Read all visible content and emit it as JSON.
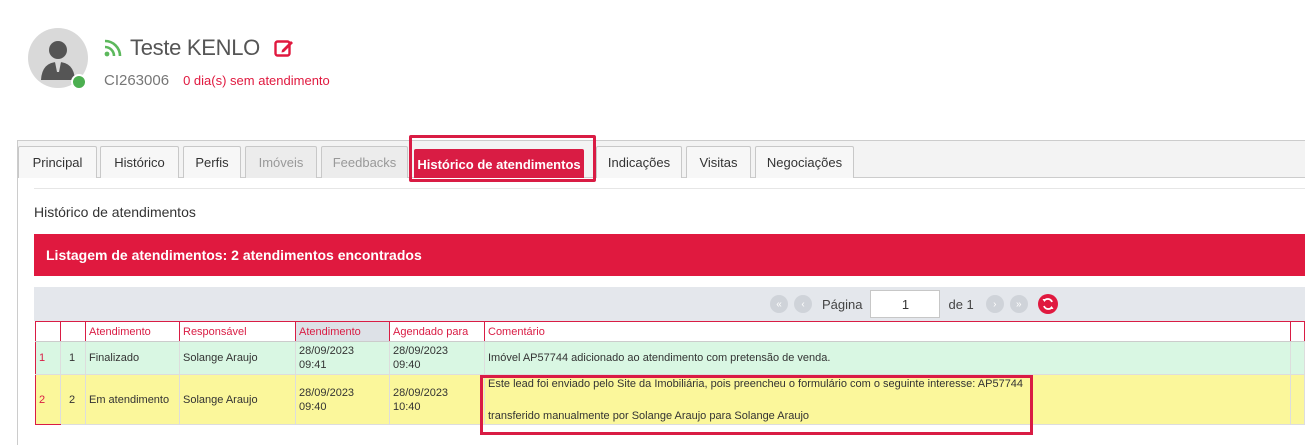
{
  "header": {
    "name": "Teste KENLO",
    "code": "CI263006",
    "days_count": "0 dia(s)",
    "days_suffix": "sem atendimento"
  },
  "tabs": [
    {
      "label": "Principal",
      "state": "normal"
    },
    {
      "label": "Histórico",
      "state": "normal"
    },
    {
      "label": "Perfis",
      "state": "normal"
    },
    {
      "label": "Imóveis",
      "state": "disabled"
    },
    {
      "label": "Feedbacks",
      "state": "disabled"
    },
    {
      "label": "Histórico de atendimentos",
      "state": "active"
    },
    {
      "label": "Indicações",
      "state": "normal"
    },
    {
      "label": "Visitas",
      "state": "normal"
    },
    {
      "label": "Negociações",
      "state": "normal"
    }
  ],
  "section_title": "Histórico de atendimentos",
  "listing_title": "Listagem de atendimentos: 2 atendimentos encontrados",
  "pager": {
    "page_label": "Página",
    "page_value": "1",
    "of_label": "de 1"
  },
  "table": {
    "columns": [
      "Atendimento",
      "Responsável",
      "Atendimento",
      "Agendado para",
      "Comentário"
    ],
    "rows": [
      {
        "row_number": "1",
        "index": "1",
        "status": "Finalizado",
        "responsible": "Solange Araujo",
        "attended_date": "28/09/2023",
        "attended_time": "09:41",
        "scheduled_date": "28/09/2023",
        "scheduled_time": "09:40",
        "comment_line1": "Imóvel AP57744 adicionado ao atendimento com pretensão de venda.",
        "comment_line2": ""
      },
      {
        "row_number": "2",
        "index": "2",
        "status": "Em atendimento",
        "responsible": "Solange Araujo",
        "attended_date": "28/09/2023",
        "attended_time": "09:40",
        "scheduled_date": "28/09/2023",
        "scheduled_time": "10:40",
        "comment_line1": "Este lead foi enviado pelo Site da Imobiliária, pois preencheu o formulário com o seguinte interesse: AP57744",
        "comment_line2": "transferido manualmente por Solange Araujo para Solange Araujo"
      }
    ]
  },
  "colors": {
    "accent": "#e0193f",
    "online": "#4caf50",
    "row_done": "#d9f7e3",
    "row_open": "#fbf79b"
  },
  "icons": [
    "user-avatar-icon",
    "rss-icon",
    "edit-icon",
    "first-page-icon",
    "prev-page-icon",
    "next-page-icon",
    "last-page-icon",
    "refresh-icon"
  ]
}
